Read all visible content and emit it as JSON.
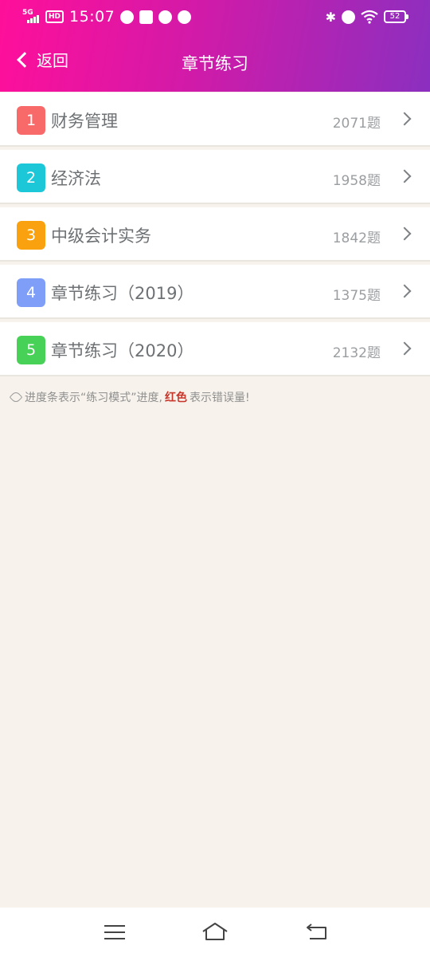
{
  "status_bar": {
    "network": "5G",
    "hd": "HD",
    "time": "15:07",
    "battery": "52"
  },
  "nav": {
    "back_label": "返回",
    "title": "章节练习"
  },
  "chapters": [
    {
      "index": "1",
      "title": "财务管理",
      "count": "2071题",
      "color": "#f86a6a"
    },
    {
      "index": "2",
      "title": "经济法",
      "count": "1958题",
      "color": "#1cc8d8"
    },
    {
      "index": "3",
      "title": "中级会计实务",
      "count": "1842题",
      "color": "#f9a10e"
    },
    {
      "index": "4",
      "title": "章节练习（2019）",
      "count": "1375题",
      "color": "#7f9ef8"
    },
    {
      "index": "5",
      "title": "章节练习（2020）",
      "count": "2132题",
      "color": "#47d157"
    }
  ],
  "note": {
    "text_before": "进度条表示“练习模式”进度,",
    "highlight": "红色",
    "text_after": "表示错误量!"
  },
  "colors": {
    "header_start": "#ff0f9a",
    "header_end": "#8b2fc0",
    "background": "#f7f3ec",
    "note_highlight": "#c8362b"
  }
}
